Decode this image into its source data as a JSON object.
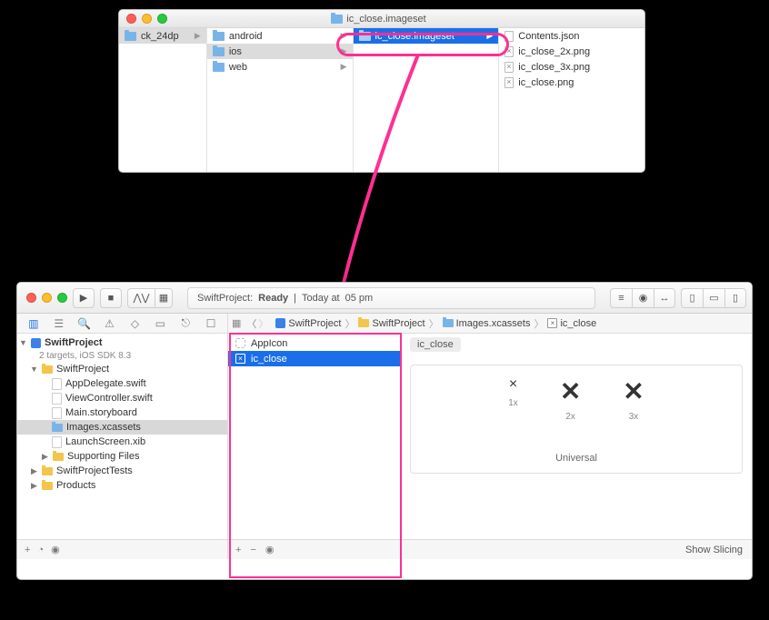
{
  "finder": {
    "title": "ic_close.imageset",
    "col0": {
      "item": "ck_24dp"
    },
    "col1": {
      "items": [
        "android",
        "ios",
        "web"
      ]
    },
    "col2": {
      "selected": "ic_close.imageset"
    },
    "col3": {
      "items": [
        "Contents.json",
        "ic_close_2x.png",
        "ic_close_3x.png",
        "ic_close.png"
      ]
    }
  },
  "xcode": {
    "status_project": "SwiftProject:",
    "status_state": "Ready",
    "status_sep": "|",
    "status_time_prefix": "Today at",
    "status_time": "05 pm",
    "jump": [
      "SwiftProject",
      "SwiftProject",
      "Images.xcassets",
      "ic_close"
    ],
    "tree": {
      "project": "SwiftProject",
      "subtitle": "2 targets, iOS SDK 8.3",
      "group1": "SwiftProject",
      "files": [
        "AppDelegate.swift",
        "ViewController.swift",
        "Main.storyboard",
        "Images.xcassets",
        "LaunchScreen.xib"
      ],
      "supporting": "Supporting Files",
      "tests": "SwiftProjectTests",
      "products": "Products"
    },
    "catalog": {
      "items": [
        "AppIcon",
        "ic_close"
      ]
    },
    "canvas": {
      "set_name": "ic_close",
      "scales": [
        "1x",
        "2x",
        "3x"
      ],
      "universal": "Universal",
      "show_slicing": "Show Slicing"
    }
  }
}
